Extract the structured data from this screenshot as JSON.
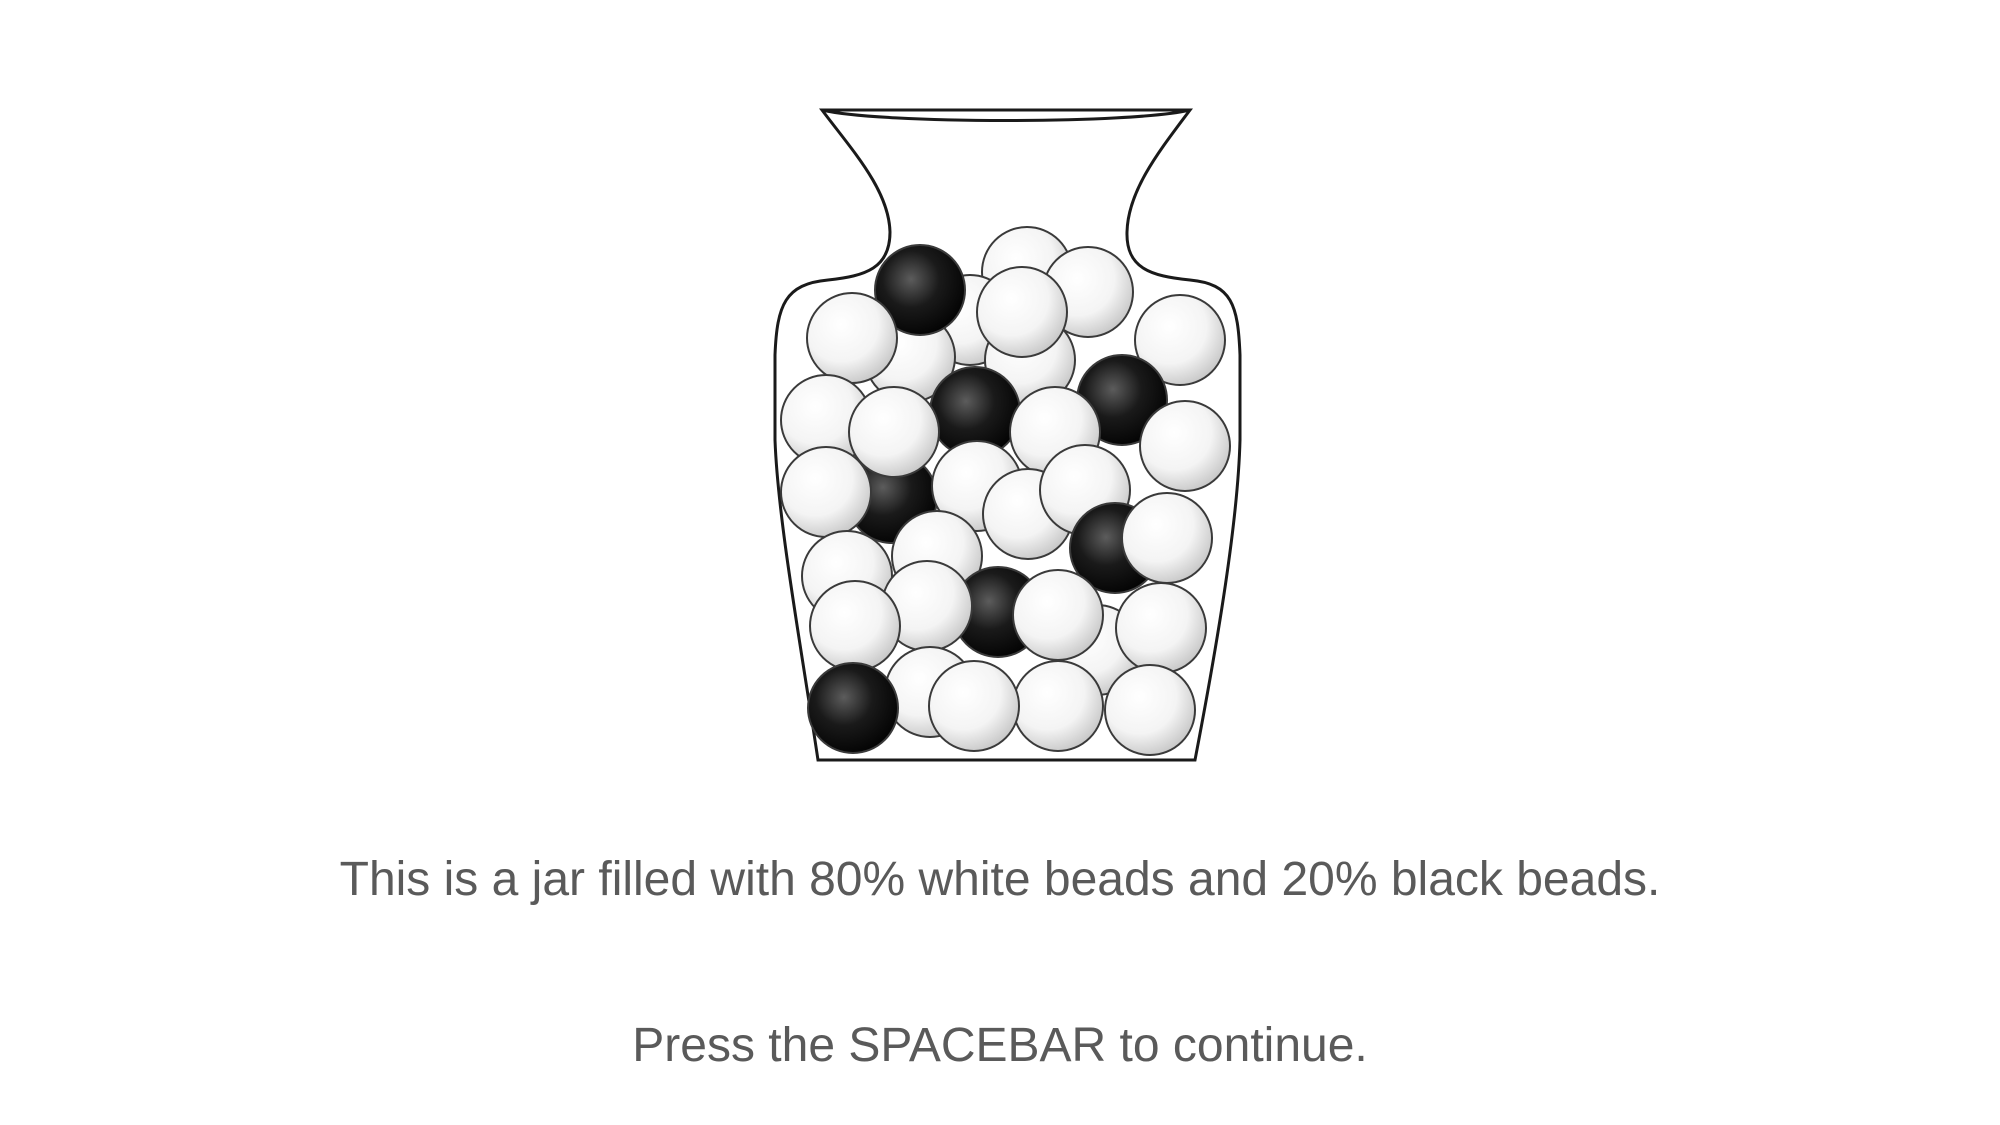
{
  "stimulus": {
    "description": "This is a jar filled with 80% white beads and 20% black beads.",
    "white_bead_percent": 80,
    "black_bead_percent": 20,
    "white_color": "#ffffff",
    "black_color": "#000000"
  },
  "prompt": {
    "continue_text": "Press the SPACEBAR to continue.",
    "continue_key": "SPACEBAR"
  },
  "colors": {
    "text": "#5a5a5a",
    "background": "#ffffff",
    "outline": "#1a1a1a"
  }
}
